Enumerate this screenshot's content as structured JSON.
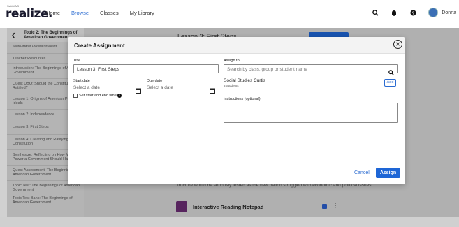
{
  "app": {
    "logo_small": "SAVVAS",
    "logo_big": "realize."
  },
  "nav": {
    "links": [
      "Home",
      "Browse",
      "Classes",
      "My Library"
    ],
    "active": "Browse",
    "icons": [
      "search-icon",
      "bell-icon",
      "help-icon",
      "avatar"
    ],
    "username": "Donna"
  },
  "sidebar": {
    "header": "Topic 2: The Beginnings of American Government",
    "subheader": "Show Distance Learning Resources",
    "items": [
      "Teacher Resources",
      "Introduction: The Beginnings of American Government",
      "Quest DBQ: Should the Constitution Be Ratified?",
      "Lesson 1: Origins of American Political Ideals",
      "Lesson 2: Independence",
      "Lesson 3: First Steps",
      "Lesson 4: Creating and Ratifying the Constitution",
      "Synthesize: Reflecting on How Much Power a Government Should Have",
      "Quest Assessment: The Beginnings of American Government",
      "Topic Test: The Beginnings of American Government",
      "Topic Test Bank: The Beginnings of American Government"
    ]
  },
  "main": {
    "title": "Lesson 3: First Steps",
    "body_text": "tructure would be seriously tested as the new nation struggled with economic and political issues.",
    "resource_label": "Interactive Reading Notepad"
  },
  "modal": {
    "title": "Create Assignment",
    "title_label": "Title",
    "title_value": "Lesson 3: First Steps",
    "start_label": "Start date",
    "start_placeholder": "Select a date",
    "due_label": "Due date",
    "due_placeholder": "Select a date",
    "times_label": "Set start and end times",
    "assign_to_label": "Assign to",
    "assign_placeholder": "Search by class, group or student name",
    "class_name": "Social Studies Curtis",
    "class_count": "3 Students",
    "add_label": "Add",
    "instructions_label": "Instructions (optional)",
    "cancel_label": "Cancel",
    "assign_label": "Assign"
  },
  "colors": {
    "accent": "#1e66d6",
    "link": "#2a6bd1",
    "resource_icon": "#6b2c73"
  }
}
